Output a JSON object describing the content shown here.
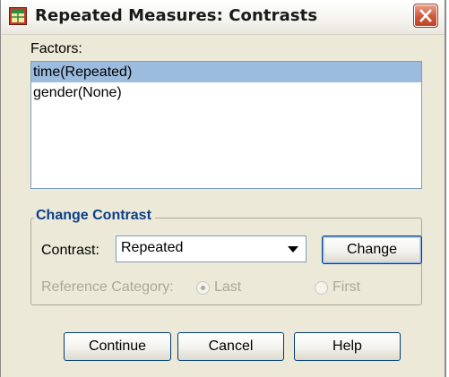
{
  "window": {
    "title": "Repeated Measures: Contrasts",
    "app_icon": "spss-dialog-icon",
    "close_icon": "close-icon"
  },
  "factors": {
    "label": "Factors:",
    "items": [
      "time(Repeated)",
      "gender(None)"
    ],
    "selected_index": 0
  },
  "change_contrast": {
    "group_title": "Change Contrast",
    "contrast_label": "Contrast:",
    "contrast_value": "Repeated",
    "change_button": "Change",
    "reference_category_label": "Reference Category:",
    "reference_options": [
      "Last",
      "First"
    ],
    "reference_selected": "Last",
    "reference_enabled": false
  },
  "buttons": {
    "continue": "Continue",
    "cancel": "Cancel",
    "help": "Help"
  },
  "colors": {
    "dialog_bg": "#ece9d8",
    "selection": "#9bbcde",
    "group_title": "#0a3f8a",
    "close_button": "#d0563b",
    "disabled_text": "#aca899"
  }
}
